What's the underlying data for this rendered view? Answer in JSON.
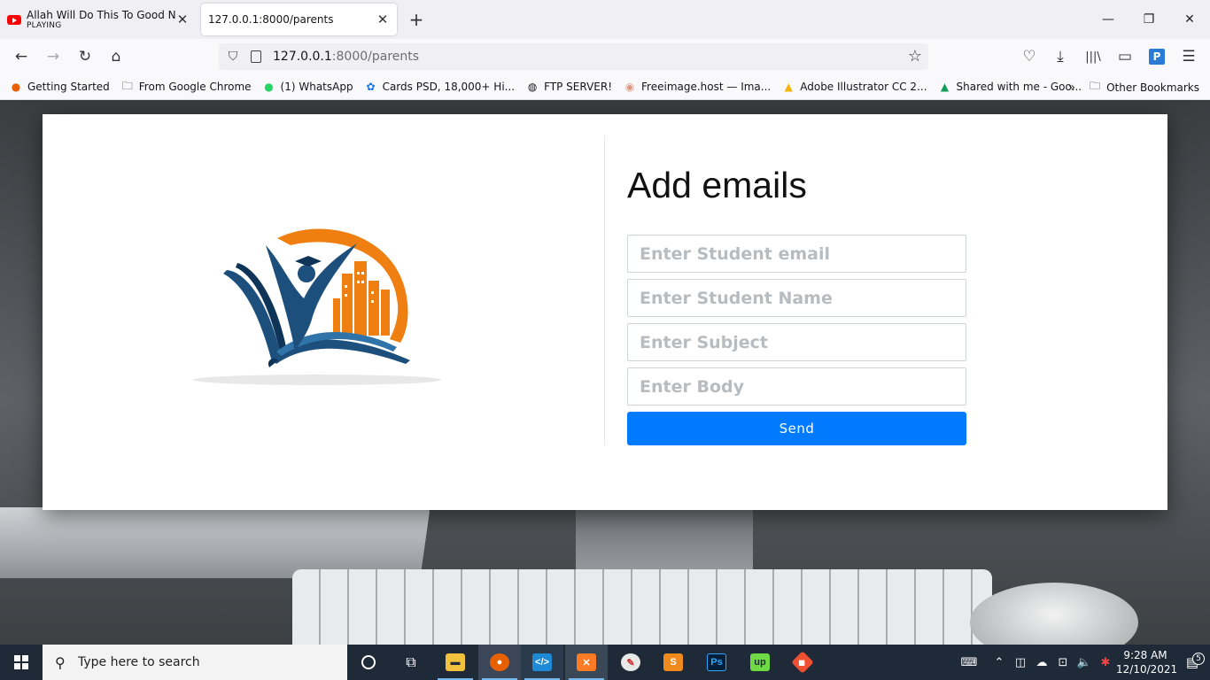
{
  "browser": {
    "tabs": [
      {
        "title": "Allah Will Do This To Good Non",
        "subtitle": "PLAYING",
        "icon": "youtube-icon"
      },
      {
        "title": "127.0.0.1:8000/parents",
        "icon": "none"
      }
    ],
    "url_host": "127.0.0.1",
    "url_path": ":8000/parents",
    "bookmarks": [
      {
        "label": "Getting Started",
        "icon": "firefox-icon"
      },
      {
        "label": "From Google Chrome",
        "icon": "folder-icon"
      },
      {
        "label": "(1) WhatsApp",
        "icon": "whatsapp-icon"
      },
      {
        "label": "Cards PSD, 18,000+ Hi...",
        "icon": "freepik-icon"
      },
      {
        "label": "FTP SERVER!",
        "icon": "globe-icon"
      },
      {
        "label": "Freeimage.host — Ima...",
        "icon": "freeimage-icon"
      },
      {
        "label": "Adobe Illustrator CC 2...",
        "icon": "google-drive-icon"
      },
      {
        "label": "Shared with me - Goo...",
        "icon": "google-drive-icon"
      }
    ],
    "other_bookmarks": "Other Bookmarks"
  },
  "page": {
    "heading": "Add emails",
    "fields": [
      {
        "placeholder": "Enter Student email",
        "value": ""
      },
      {
        "placeholder": "Enter Student Name",
        "value": ""
      },
      {
        "placeholder": "Enter Subject",
        "value": ""
      },
      {
        "placeholder": "Enter Body",
        "value": ""
      }
    ],
    "send_label": "Send",
    "accent_color": "#007bff"
  },
  "taskbar": {
    "search_placeholder": "Type here to search",
    "time": "9:28 AM",
    "date": "12/10/2021",
    "notification_count": "5",
    "apps": [
      "cortana-icon",
      "task-view-icon",
      "file-explorer-icon",
      "firefox-icon",
      "vscode-icon",
      "xampp-icon",
      "paint-icon",
      "sublime-text-icon",
      "photoshop-icon",
      "upwork-icon",
      "git-icon"
    ]
  }
}
